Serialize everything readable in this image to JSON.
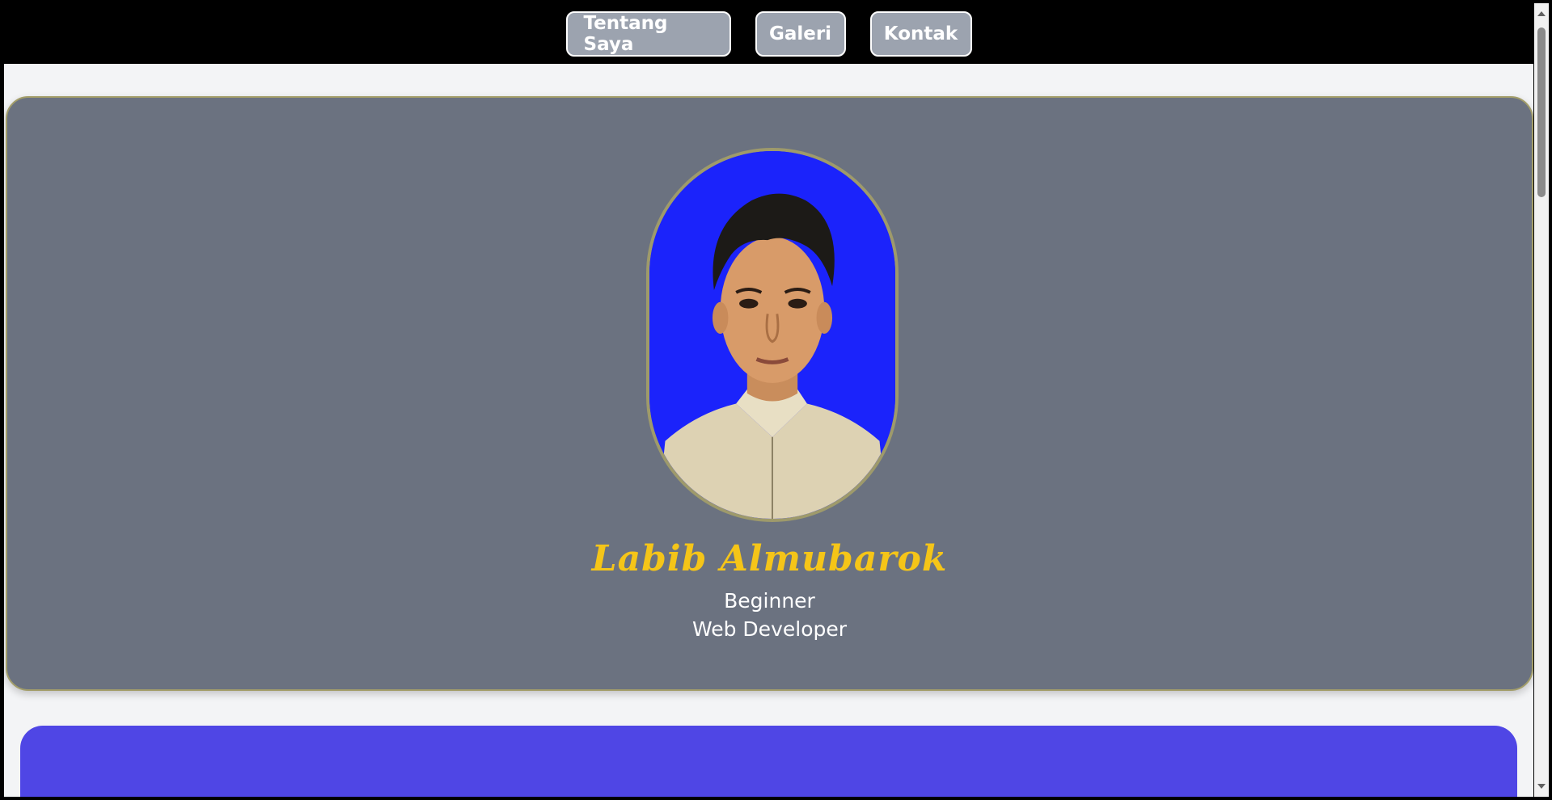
{
  "nav": {
    "items": [
      {
        "label": "Tentang Saya"
      },
      {
        "label": "Galeri"
      },
      {
        "label": "Kontak"
      }
    ]
  },
  "hero": {
    "name": "Labib Almubarok",
    "role_line1": "Beginner",
    "role_line2": "Web Developer",
    "photo_icon": "profile-photo"
  },
  "colors": {
    "nav_bg": "#000000",
    "nav_button_bg": "#9ca3af",
    "hero_bg": "#6b7280",
    "hero_border": "#a39e6a",
    "name_color": "#f5c518",
    "photo_bg": "#1b23fb",
    "section_bg": "#4f46e5"
  }
}
